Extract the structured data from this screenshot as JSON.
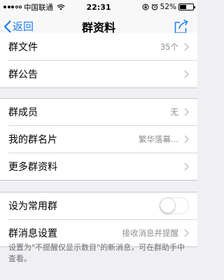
{
  "status_bar": {
    "carrier": "中国联通",
    "time": "22:31",
    "battery_percent": "52%",
    "battery_level": 0.52
  },
  "nav": {
    "back_label": "返回",
    "title": "群资料"
  },
  "group1": [
    {
      "label": "群文件",
      "value": "35个"
    },
    {
      "label": "群公告",
      "value": ""
    }
  ],
  "group2": [
    {
      "label": "群成员",
      "value": "无"
    },
    {
      "label": "我的群名片",
      "value": "繁华落幕..."
    },
    {
      "label": "更多群资料",
      "value": ""
    }
  ],
  "group3": {
    "favorite_label": "设为常用群",
    "favorite_on": false,
    "message_settings_label": "群消息设置",
    "message_settings_value": "接收消息并提醒"
  },
  "footnote": "设置为\"不提醒仅显示数目\"的新消息，可在群助手中查看。",
  "colors": {
    "accent": "#1a7cf4",
    "background": "#efeff4"
  }
}
